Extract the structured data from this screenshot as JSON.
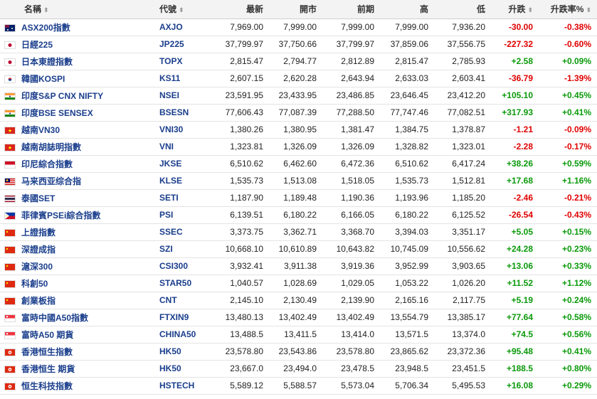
{
  "header": {
    "name": "名稱",
    "code": "代號",
    "last": "最新",
    "open": "開市",
    "prev": "前期",
    "high": "高",
    "low": "低",
    "change": "升跌",
    "change_pct": "升跌率%"
  },
  "colors": {
    "up": "#0a9a0a",
    "down": "#e00000",
    "link": "#1a3e8c"
  },
  "rows": [
    {
      "flag": "au-flag-icon",
      "name": "ASX200指數",
      "code": "AXJO",
      "last": "7,969.00",
      "open": "7,999.00",
      "prev": "7,999.00",
      "high": "7,999.00",
      "low": "7,936.20",
      "change": "-30.00",
      "change_pct": "-0.38%",
      "dir": "down"
    },
    {
      "flag": "jp-flag-icon",
      "name": "日經225",
      "code": "JP225",
      "last": "37,799.97",
      "open": "37,750.66",
      "prev": "37,799.97",
      "high": "37,859.06",
      "low": "37,556.75",
      "change": "-227.32",
      "change_pct": "-0.60%",
      "dir": "down"
    },
    {
      "flag": "jp-flag-icon",
      "name": "日本東證指數",
      "code": "TOPX",
      "last": "2,815.47",
      "open": "2,794.77",
      "prev": "2,812.89",
      "high": "2,815.47",
      "low": "2,785.93",
      "change": "+2.58",
      "change_pct": "+0.09%",
      "dir": "up"
    },
    {
      "flag": "kr-flag-icon",
      "name": "韓國KOSPI",
      "code": "KS11",
      "last": "2,607.15",
      "open": "2,620.28",
      "prev": "2,643.94",
      "high": "2,633.03",
      "low": "2,603.41",
      "change": "-36.79",
      "change_pct": "-1.39%",
      "dir": "down"
    },
    {
      "flag": "in-flag-icon",
      "name": "印度S&P CNX NIFTY",
      "code": "NSEI",
      "last": "23,591.95",
      "open": "23,433.95",
      "prev": "23,486.85",
      "high": "23,646.45",
      "low": "23,412.20",
      "change": "+105.10",
      "change_pct": "+0.45%",
      "dir": "up"
    },
    {
      "flag": "in-flag-icon",
      "name": "印度BSE SENSEX",
      "code": "BSESN",
      "last": "77,606.43",
      "open": "77,087.39",
      "prev": "77,288.50",
      "high": "77,747.46",
      "low": "77,082.51",
      "change": "+317.93",
      "change_pct": "+0.41%",
      "dir": "up"
    },
    {
      "flag": "vn-flag-icon",
      "name": "越南VN30",
      "code": "VNI30",
      "last": "1,380.26",
      "open": "1,380.95",
      "prev": "1,381.47",
      "high": "1,384.75",
      "low": "1,378.87",
      "change": "-1.21",
      "change_pct": "-0.09%",
      "dir": "down"
    },
    {
      "flag": "vn-flag-icon",
      "name": "越南胡誌明指數",
      "code": "VNI",
      "last": "1,323.81",
      "open": "1,326.09",
      "prev": "1,326.09",
      "high": "1,328.82",
      "low": "1,323.01",
      "change": "-2.28",
      "change_pct": "-0.17%",
      "dir": "down"
    },
    {
      "flag": "id-flag-icon",
      "name": "印尼綜合指數",
      "code": "JKSE",
      "last": "6,510.62",
      "open": "6,462.60",
      "prev": "6,472.36",
      "high": "6,510.62",
      "low": "6,417.24",
      "change": "+38.26",
      "change_pct": "+0.59%",
      "dir": "up"
    },
    {
      "flag": "my-flag-icon",
      "name": "马来西亚综合指",
      "code": "KLSE",
      "last": "1,535.73",
      "open": "1,513.08",
      "prev": "1,518.05",
      "high": "1,535.73",
      "low": "1,512.81",
      "change": "+17.68",
      "change_pct": "+1.16%",
      "dir": "up"
    },
    {
      "flag": "th-flag-icon",
      "name": "泰國SET",
      "code": "SETI",
      "last": "1,187.90",
      "open": "1,189.48",
      "prev": "1,190.36",
      "high": "1,193.96",
      "low": "1,185.20",
      "change": "-2.46",
      "change_pct": "-0.21%",
      "dir": "down"
    },
    {
      "flag": "ph-flag-icon",
      "name": "菲律賓PSEi綜合指數",
      "code": "PSI",
      "last": "6,139.51",
      "open": "6,180.22",
      "prev": "6,166.05",
      "high": "6,180.22",
      "low": "6,125.52",
      "change": "-26.54",
      "change_pct": "-0.43%",
      "dir": "down"
    },
    {
      "flag": "cn-flag-icon",
      "name": "上證指數",
      "code": "SSEC",
      "last": "3,373.75",
      "open": "3,362.71",
      "prev": "3,368.70",
      "high": "3,394.03",
      "low": "3,351.17",
      "change": "+5.05",
      "change_pct": "+0.15%",
      "dir": "up"
    },
    {
      "flag": "cn-flag-icon",
      "name": "深證成指",
      "code": "SZI",
      "last": "10,668.10",
      "open": "10,610.89",
      "prev": "10,643.82",
      "high": "10,745.09",
      "low": "10,556.62",
      "change": "+24.28",
      "change_pct": "+0.23%",
      "dir": "up"
    },
    {
      "flag": "cn-flag-icon",
      "name": "滬深300",
      "code": "CSI300",
      "last": "3,932.41",
      "open": "3,911.38",
      "prev": "3,919.36",
      "high": "3,952.99",
      "low": "3,903.65",
      "change": "+13.06",
      "change_pct": "+0.33%",
      "dir": "up"
    },
    {
      "flag": "cn-flag-icon",
      "name": "科創50",
      "code": "STAR50",
      "last": "1,040.57",
      "open": "1,028.69",
      "prev": "1,029.05",
      "high": "1,053.22",
      "low": "1,026.20",
      "change": "+11.52",
      "change_pct": "+1.12%",
      "dir": "up"
    },
    {
      "flag": "cn-flag-icon",
      "name": "創業板指",
      "code": "CNT",
      "last": "2,145.10",
      "open": "2,130.49",
      "prev": "2,139.90",
      "high": "2,165.16",
      "low": "2,117.75",
      "change": "+5.19",
      "change_pct": "+0.24%",
      "dir": "up"
    },
    {
      "flag": "sg-flag-icon",
      "name": "富時中國A50指數",
      "code": "FTXIN9",
      "last": "13,480.13",
      "open": "13,402.49",
      "prev": "13,402.49",
      "high": "13,554.79",
      "low": "13,385.17",
      "change": "+77.64",
      "change_pct": "+0.58%",
      "dir": "up"
    },
    {
      "flag": "sg-flag-icon",
      "name": "富時A50 期貨",
      "code": "CHINA50",
      "last": "13,488.5",
      "open": "13,411.5",
      "prev": "13,414.0",
      "high": "13,571.5",
      "low": "13,374.0",
      "change": "+74.5",
      "change_pct": "+0.56%",
      "dir": "up"
    },
    {
      "flag": "hk-flag-icon",
      "name": "香港恒生指數",
      "code": "HK50",
      "last": "23,578.80",
      "open": "23,543.86",
      "prev": "23,578.80",
      "high": "23,865.62",
      "low": "23,372.36",
      "change": "+95.48",
      "change_pct": "+0.41%",
      "dir": "up"
    },
    {
      "flag": "hk-flag-icon",
      "name": "香港恒生 期貨",
      "code": "HK50",
      "last": "23,667.0",
      "open": "23,494.0",
      "prev": "23,478.5",
      "high": "23,948.5",
      "low": "23,451.5",
      "change": "+188.5",
      "change_pct": "+0.80%",
      "dir": "up"
    },
    {
      "flag": "hk-flag-icon",
      "name": "恒生科技指數",
      "code": "HSTECH",
      "last": "5,589.12",
      "open": "5,588.57",
      "prev": "5,573.04",
      "high": "5,706.34",
      "low": "5,495.53",
      "change": "+16.08",
      "change_pct": "+0.29%",
      "dir": "up"
    }
  ]
}
